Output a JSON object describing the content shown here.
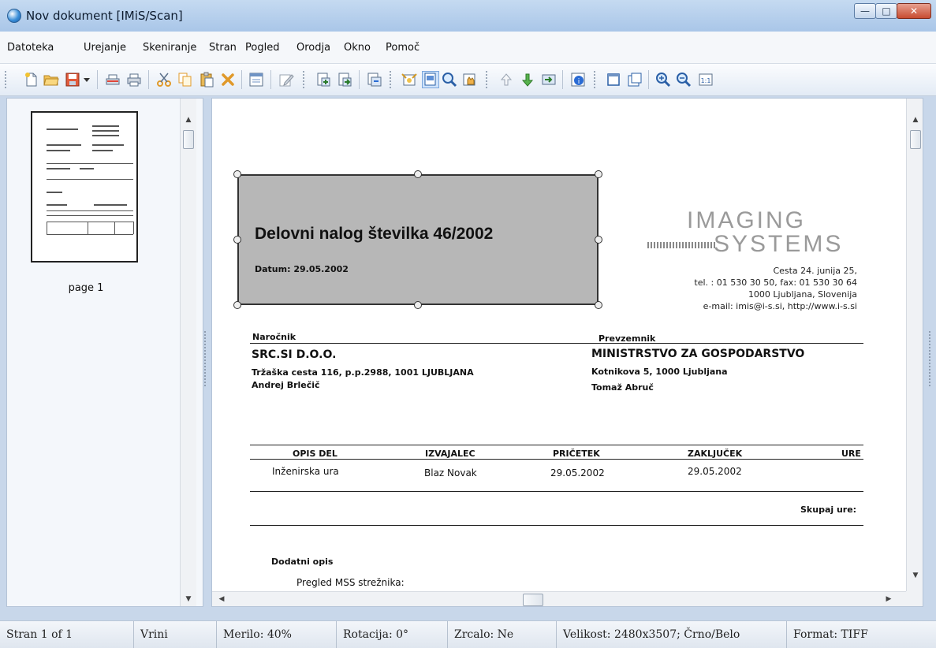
{
  "window": {
    "title": "Nov dokument [IMiS/Scan]"
  },
  "menu": [
    "Datoteka",
    "Urejanje",
    "Skeniranje",
    "Stran",
    "Pogled",
    "Orodja",
    "Okno",
    "Pomoč"
  ],
  "toolbar_icons": [
    "new-document-icon",
    "open-folder-icon",
    "save-icon",
    "dropdown-arrow-icon",
    "scan-icon",
    "print-icon",
    "cut-icon",
    "copy-icon",
    "paste-icon",
    "delete-icon",
    "page-setup-icon",
    "edit-icon",
    "insert-page-icon",
    "append-page-icon",
    "import-icon",
    "auto-crop-icon",
    "select-area-icon",
    "zoom-tool-icon",
    "pan-tool-icon",
    "move-up-icon",
    "move-down-icon",
    "send-icon",
    "info-icon",
    "fit-page-icon",
    "fit-width-icon",
    "zoom-in-icon",
    "zoom-out-icon",
    "actual-size-icon"
  ],
  "thumbnails": [
    {
      "label": "page 1"
    }
  ],
  "document": {
    "title": "Delovni nalog številka 46/2002",
    "date": "Datum: 29.05.2002",
    "logo_line1": "IMAGING",
    "logo_line2": "SYSTEMS",
    "address": [
      "Cesta 24. junija 25,",
      "tel. : 01 530 30 50, fax: 01 530 30 64",
      "1000 Ljubljana, Slovenija",
      "e-mail: imis@i-s.si, http://www.i-s.si"
    ],
    "client_label": "Naročnik",
    "client_name": "SRC.SI D.O.O.",
    "client_address": "Tržaška cesta 116, p.p.2988,  1001  LJUBLJANA",
    "client_person": "Andrej Brlečič",
    "recipient_label": "Prevzemnik",
    "recipient_name": "MINISTRSTVO ZA GOSPODARSTVO",
    "recipient_address": "Kotnikova 5,  1000 Ljubljana",
    "recipient_person": "Tomaž Abruč",
    "table_headers": [
      "OPIS DEL",
      "IZVAJALEC",
      "PRIČETEK",
      "ZAKLJUČEK",
      "URE"
    ],
    "table_row": [
      "Inženirska ura",
      "Blaz Novak",
      "29.05.2002",
      "29.05.2002"
    ],
    "total_label": "Skupaj ure:",
    "extra_label": "Dodatni opis",
    "extra_text": "Pregled MSS strežnika:"
  },
  "statusbar": [
    "Stran 1 of 1",
    "Vrini",
    "Merilo: 40%",
    "Rotacija: 0°",
    "Zrcalo: Ne",
    "Velikost: 2480x3507; Črno/Belo",
    "Format: TIFF"
  ]
}
